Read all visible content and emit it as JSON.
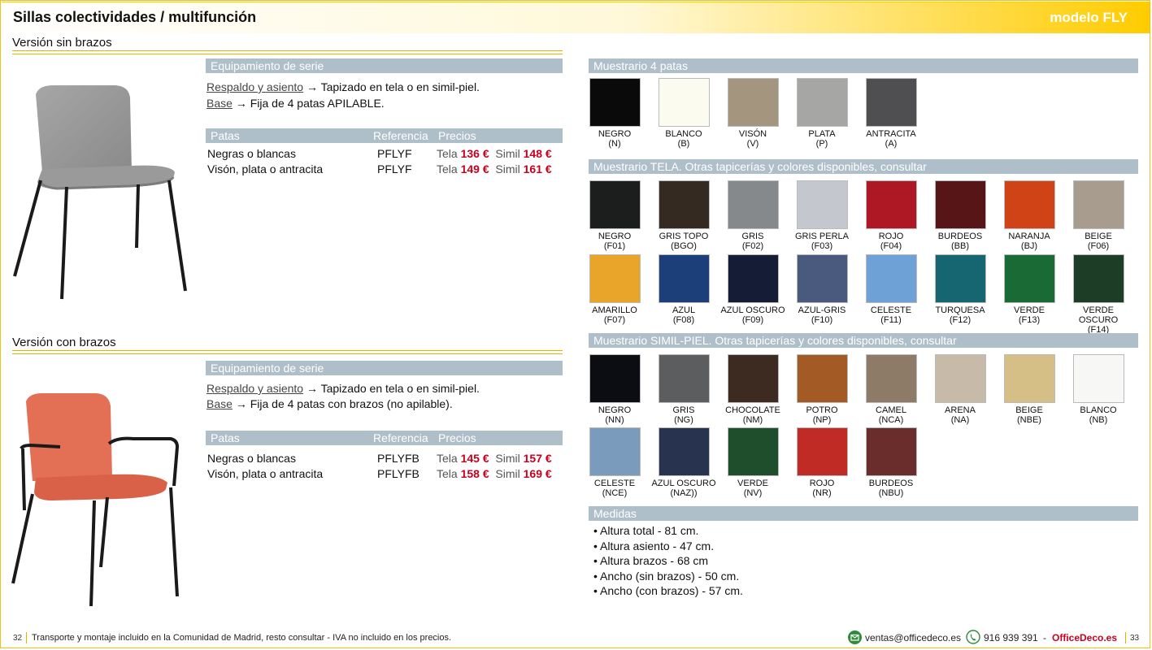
{
  "header": {
    "title": "Sillas colectividades / multifunción",
    "model": "modelo FLY"
  },
  "variants": [
    {
      "title": "Versión sin brazos",
      "equip_title": "Equipamiento de serie",
      "specs": [
        {
          "label": "Respaldo y asiento",
          "text": "Tapizado en tela o en simil-piel."
        },
        {
          "label": "Base",
          "text": "Fija de 4 patas APILABLE."
        }
      ],
      "table_headers": {
        "patas": "Patas",
        "ref": "Referencia",
        "precios": "Precios"
      },
      "rows": [
        {
          "patas": "Negras o blancas",
          "ref": "PFLYF",
          "tela_label": "Tela",
          "tela": "136 €",
          "simil_label": "Simil",
          "simil": "148 €"
        },
        {
          "patas": "Visón, plata o antracita",
          "ref": "PFLYF",
          "tela_label": "Tela",
          "tela": "149 €",
          "simil_label": "Simil",
          "simil": "161 €"
        }
      ]
    },
    {
      "title": "Versión con brazos",
      "equip_title": "Equipamiento de serie",
      "specs": [
        {
          "label": "Respaldo y asiento",
          "text": "Tapizado en tela o en simil-piel."
        },
        {
          "label": "Base",
          "text": "Fija de 4 patas con brazos (no apilable)."
        }
      ],
      "table_headers": {
        "patas": "Patas",
        "ref": "Referencia",
        "precios": "Precios"
      },
      "rows": [
        {
          "patas": "Negras o blancas",
          "ref": "PFLYFB",
          "tela_label": "Tela",
          "tela": "145 €",
          "simil_label": "Simil",
          "simil": "157 €"
        },
        {
          "patas": "Visón, plata o antracita",
          "ref": "PFLYFB",
          "tela_label": "Tela",
          "tela": "158 €",
          "simil_label": "Simil",
          "simil": "169 €"
        }
      ]
    }
  ],
  "arrow": "→",
  "muestrario_patas": {
    "title": "Muestrario 4 patas",
    "items": [
      {
        "name": "NEGRO",
        "code": "(N)",
        "color": "#0a0a0a"
      },
      {
        "name": "BLANCO",
        "code": "(B)",
        "color": "#fbfbf0"
      },
      {
        "name": "VISÓN",
        "code": "(V)",
        "color": "#a4957f"
      },
      {
        "name": "PLATA",
        "code": "(P)",
        "color": "#a6a6a4"
      },
      {
        "name": "ANTRACITA",
        "code": "(A)",
        "color": "#4f4f51"
      }
    ]
  },
  "muestrario_tela": {
    "title": "Muestrario TELA. Otras tapicerías y colores disponibles, consultar",
    "items": [
      {
        "name": "NEGRO",
        "code": "(F01)",
        "color": "#1c1e1e"
      },
      {
        "name": "GRIS TOPO",
        "code": "(BGO)",
        "color": "#342a22"
      },
      {
        "name": "GRIS",
        "code": "(F02)",
        "color": "#86898c"
      },
      {
        "name": "GRIS PERLA",
        "code": "(F03)",
        "color": "#c4c7cd"
      },
      {
        "name": "ROJO",
        "code": "(F04)",
        "color": "#ae1724"
      },
      {
        "name": "BURDEOS",
        "code": "(BB)",
        "color": "#581518"
      },
      {
        "name": "NARANJA",
        "code": "(BJ)",
        "color": "#cf4316"
      },
      {
        "name": "BEIGE",
        "code": "(F06)",
        "color": "#a89c8e"
      },
      {
        "name": "AMARILLO",
        "code": "(F07)",
        "color": "#e9a52a"
      },
      {
        "name": "AZUL",
        "code": "(F08)",
        "color": "#1c3f7a"
      },
      {
        "name": "AZUL OSCURO",
        "code": "(F09)",
        "color": "#151c35"
      },
      {
        "name": "AZUL-GRIS",
        "code": "(F10)",
        "color": "#4a5a7e"
      },
      {
        "name": "CELESTE",
        "code": "(F11)",
        "color": "#6ea1d6"
      },
      {
        "name": "TURQUESA",
        "code": "(F12)",
        "color": "#156670"
      },
      {
        "name": "VERDE",
        "code": "(F13)",
        "color": "#1a6a35"
      },
      {
        "name": "VERDE OSCURO",
        "code": "(F14)",
        "color": "#1d3d26"
      }
    ]
  },
  "muestrario_simil": {
    "title": "Muestrario SIMIL-PIEL. Otras tapicerías y colores disponibles, consultar",
    "items": [
      {
        "name": "NEGRO",
        "code": "(NN)",
        "color": "#0b0d12"
      },
      {
        "name": "GRIS",
        "code": "(NG)",
        "color": "#5b5d5f"
      },
      {
        "name": "CHOCOLATE",
        "code": "(NM)",
        "color": "#3d2b22"
      },
      {
        "name": "POTRO",
        "code": "(NP)",
        "color": "#a45a24"
      },
      {
        "name": "CAMEL",
        "code": "(NCA)",
        "color": "#8d7b67"
      },
      {
        "name": "ARENA",
        "code": "(NA)",
        "color": "#c7baa8"
      },
      {
        "name": "BEIGE",
        "code": "(NBE)",
        "color": "#d5bf86"
      },
      {
        "name": "BLANCO",
        "code": "(NB)",
        "color": "#f7f7f5"
      },
      {
        "name": "CELESTE",
        "code": "(NCE)",
        "color": "#7b9bbd"
      },
      {
        "name": "AZUL OSCURO",
        "code": "(NAZ))",
        "color": "#28334f"
      },
      {
        "name": "VERDE",
        "code": "(NV)",
        "color": "#1e4e2c"
      },
      {
        "name": "ROJO",
        "code": "(NR)",
        "color": "#c02c25"
      },
      {
        "name": "BURDEOS",
        "code": "(NBU)",
        "color": "#6a2d2b"
      }
    ]
  },
  "medidas": {
    "title": "Medidas",
    "items": [
      "Altura total - 81 cm.",
      "Altura asiento - 47 cm.",
      "Altura brazos - 68 cm",
      "Ancho (sin brazos) - 50 cm.",
      "Ancho (con brazos) - 57 cm."
    ]
  },
  "footer": {
    "page_left": "32",
    "note": "Transporte y montaje incluido en la Comunidad de Madrid, resto consultar - IVA no incluido en los precios.",
    "email": "ventas@officedeco.es",
    "phone": "916 939 391",
    "dash": "-",
    "brand": "OfficeDeco.es",
    "page_right": "33"
  },
  "colors": {
    "accent": "#ffcc00",
    "bar": "#afbfca",
    "price": "#c8001e",
    "gold_line": "#e0b300",
    "brand": "#c8001e"
  }
}
